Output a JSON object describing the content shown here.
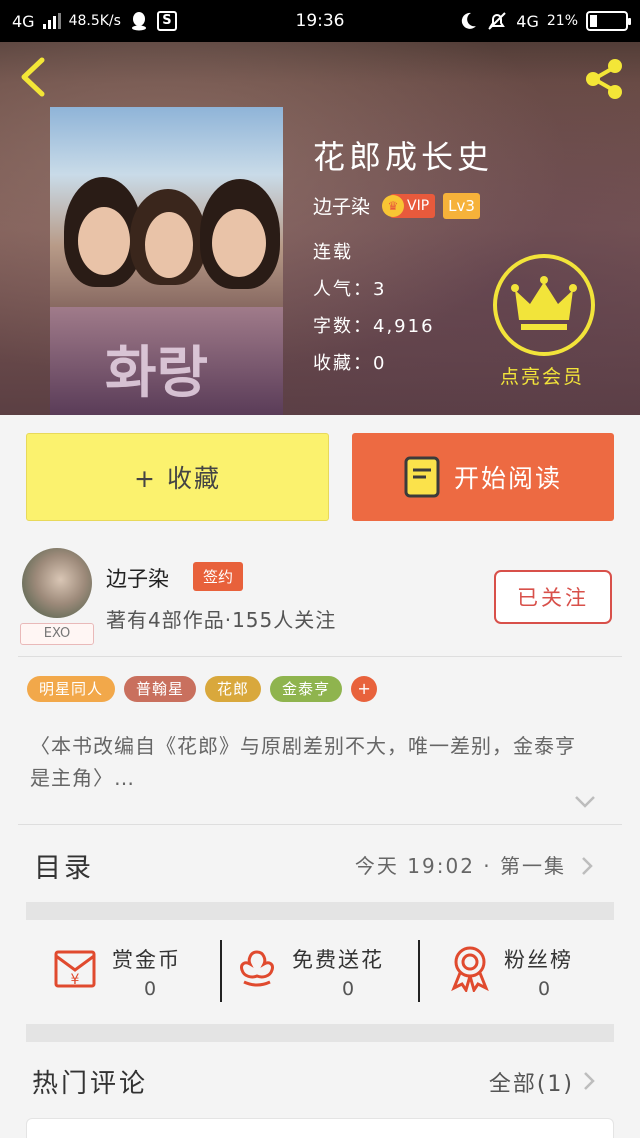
{
  "status_bar": {
    "network": "4G",
    "speed": "48.5K/s",
    "time": "19:36",
    "network_right": "4G",
    "battery": "21%"
  },
  "book": {
    "title": "花郎成长史",
    "author": "边子染",
    "vip_label": "VIP",
    "level": "Lv3",
    "serial_status": "连载",
    "popularity": "人气：3",
    "word_count": "字数：4,916",
    "favorites": "收藏：0"
  },
  "member": {
    "label": "点亮会员"
  },
  "actions": {
    "favorite_label": "+ 收藏",
    "read_label": "开始阅读"
  },
  "author_card": {
    "name": "边子染",
    "sign_tag": "签约",
    "description": "著有4部作品·155人关注",
    "avatar_tag": "EXO",
    "follow_label": "已关注"
  },
  "tags": [
    {
      "label": "明星同人",
      "color": "#f2a84a"
    },
    {
      "label": "普翰星",
      "color": "#c9705e"
    },
    {
      "label": "花郎",
      "color": "#d9a83c"
    },
    {
      "label": "金泰亨",
      "color": "#8fb44e"
    }
  ],
  "tag_add": "+",
  "summary": "〈本书改编自《花郎》与原剧差别不大，唯一差别，金泰亨是主角〉…",
  "catalog": {
    "title": "目录",
    "update": "今天 19:02 · 第一集"
  },
  "rewards": [
    {
      "label": "赏金币",
      "count": "0"
    },
    {
      "label": "免费送花",
      "count": "0"
    },
    {
      "label": "粉丝榜",
      "count": "0"
    }
  ],
  "comments": {
    "title": "热门评论",
    "all_label": "全部(1)"
  },
  "colors": {
    "accent_orange": "#ed6a42",
    "accent_yellow": "#fbf26e",
    "member_gold": "#f2e43a",
    "follow_red": "#d8504a"
  }
}
